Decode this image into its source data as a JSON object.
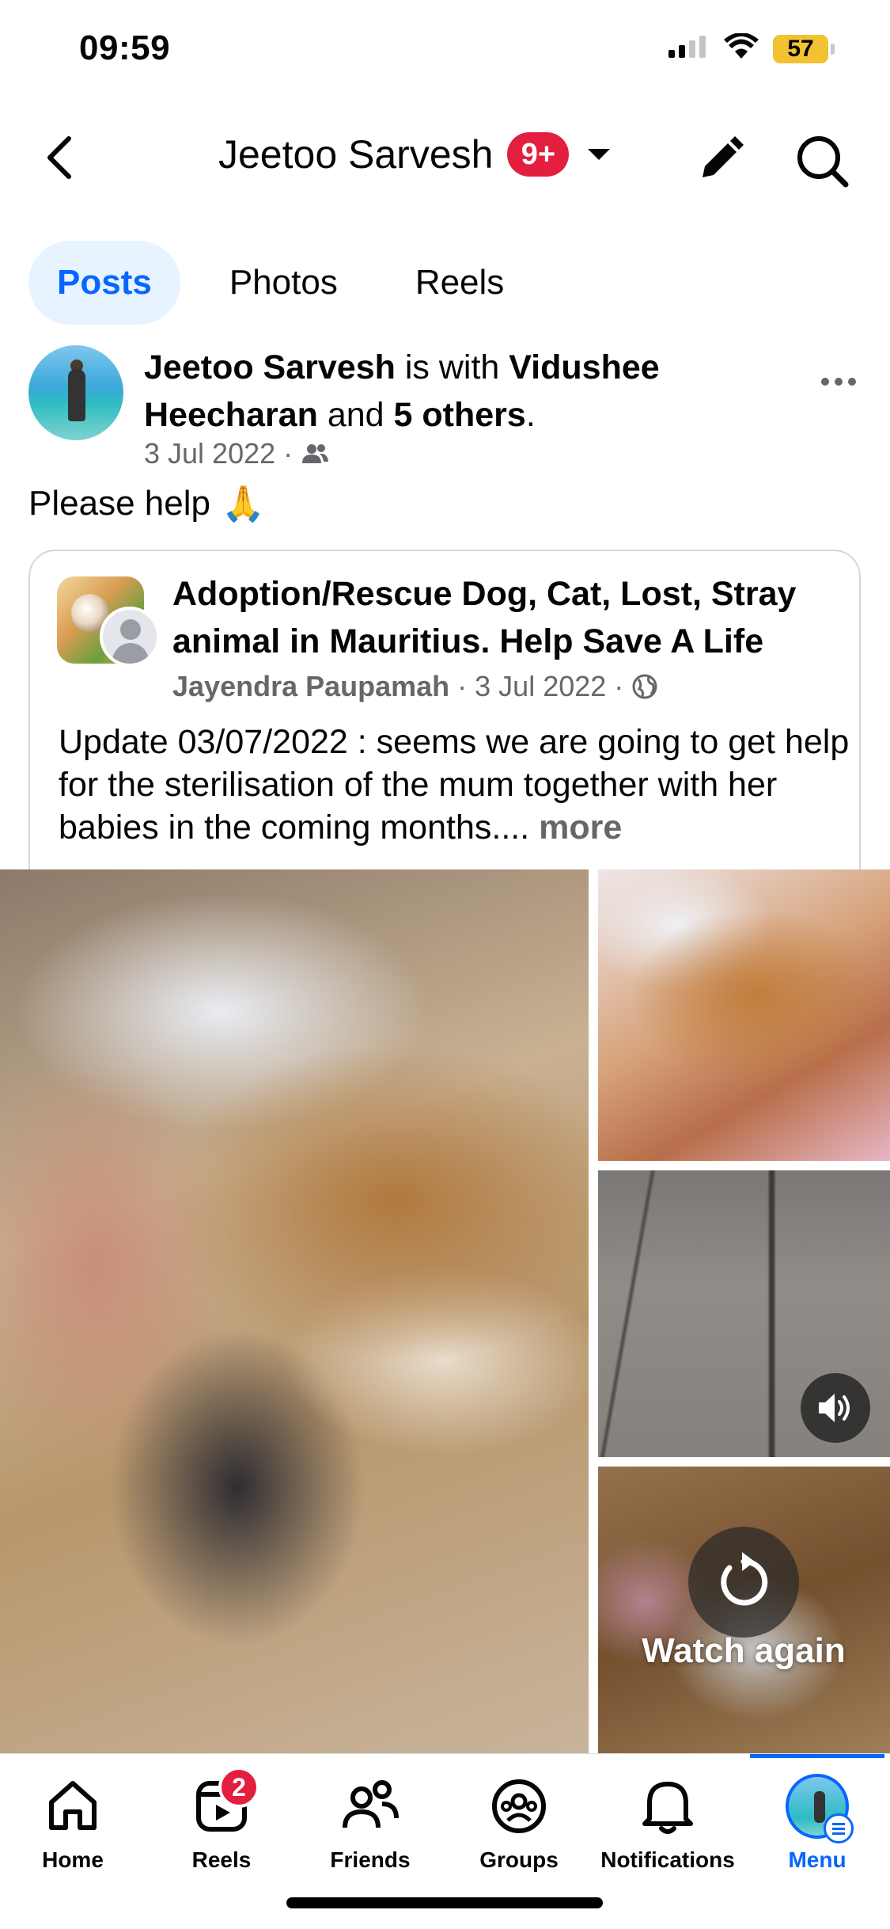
{
  "status_bar": {
    "time": "09:59",
    "battery": "57",
    "icons": [
      "cellular-signal-icon",
      "wifi-icon",
      "battery-icon"
    ]
  },
  "header": {
    "title": "Jeetoo Sarvesh",
    "badge": "9+",
    "icons": [
      "back-arrow-icon",
      "caret-down-icon",
      "pencil-icon",
      "search-icon"
    ]
  },
  "tabs": [
    {
      "label": "Posts",
      "active": true
    },
    {
      "label": "Photos",
      "active": false
    },
    {
      "label": "Reels",
      "active": false
    }
  ],
  "post": {
    "author": "Jeetoo Sarvesh",
    "with_text": " is with ",
    "tagged": "Vidushee Heecharan",
    "and_text": " and ",
    "others": "5 others",
    "period": ".",
    "date": "3 Jul 2022",
    "separator": "·",
    "audience_icon": "friends-audience-icon",
    "text": "Please help",
    "emoji": "🙏"
  },
  "shared_post": {
    "group_name": "Adoption/Rescue Dog, Cat, Lost, Stray animal in Mauritius. Help Save A Life",
    "author": "Jayendra Paupamah",
    "separator": "·",
    "date": "3 Jul 2022",
    "audience_icon": "globe-icon",
    "text": "Update 03/07/2022 : seems we are going to get help for the sterilisation of the mum together with her babies in the coming months....",
    "more_label": "more"
  },
  "media": {
    "photos": [
      {
        "name": "mother-dog-with-puppies-photo"
      },
      {
        "name": "dog-lying-on-blanket-photo"
      },
      {
        "name": "pavement-video-frame"
      },
      {
        "name": "puppies-in-box-video-frame"
      }
    ],
    "watch_again_label": "Watch again"
  },
  "bottom_nav": {
    "items": [
      {
        "label": "Home",
        "icon": "home-icon",
        "badge": null,
        "active": false
      },
      {
        "label": "Reels",
        "icon": "reels-icon",
        "badge": "2",
        "active": false
      },
      {
        "label": "Friends",
        "icon": "friends-icon",
        "badge": null,
        "active": false
      },
      {
        "label": "Groups",
        "icon": "groups-icon",
        "badge": null,
        "active": false
      },
      {
        "label": "Notifications",
        "icon": "bell-icon",
        "badge": null,
        "active": false
      },
      {
        "label": "Menu",
        "icon": "profile-menu-icon",
        "badge": null,
        "active": true
      }
    ]
  },
  "colors": {
    "accent": "#0866ff",
    "badge_red": "#e41e3f",
    "secondary_text": "#65676b",
    "active_tab_bg": "#e7f3ff"
  }
}
